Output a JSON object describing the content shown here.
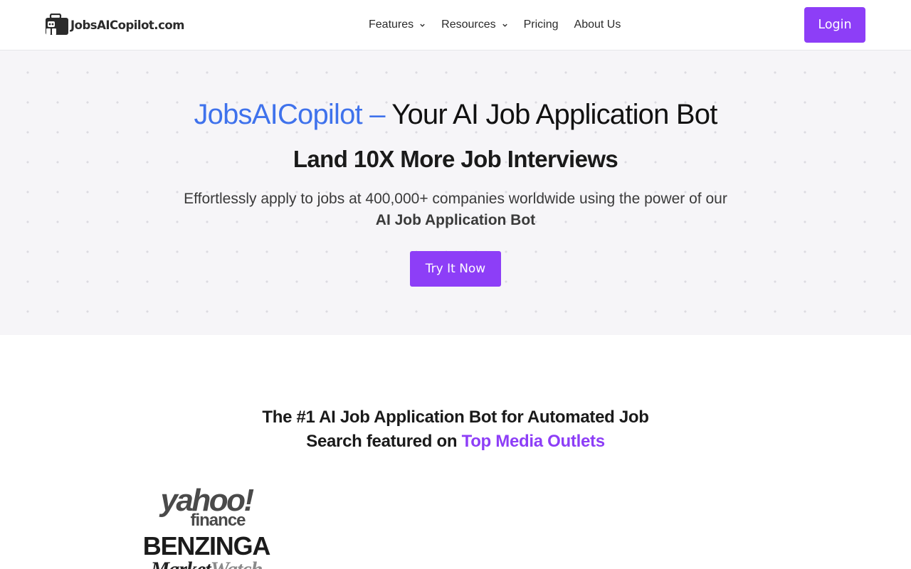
{
  "header": {
    "logo_text": "JobsAICopilot.com",
    "nav": [
      {
        "label": "Features",
        "has_dropdown": true
      },
      {
        "label": "Resources",
        "has_dropdown": true
      },
      {
        "label": "Pricing",
        "has_dropdown": false
      },
      {
        "label": "About Us",
        "has_dropdown": false
      }
    ],
    "login_label": "Login"
  },
  "hero": {
    "title_brand": "JobsAICopilot",
    "title_dash": " – ",
    "title_rest": "Your AI Job Application Bot",
    "subtitle": "Land 10X More Job Interviews",
    "description": "Effortlessly apply to jobs at 400,000+ companies worldwide using the power of our",
    "description_bold": "AI Job Application Bot",
    "cta_label": "Try It Now"
  },
  "featured": {
    "title_line1": "The #1 AI Job Application Bot for Automated Job",
    "title_line2_prefix": "Search featured on ",
    "title_line2_accent": "Top Media Outlets",
    "logos": {
      "yahoo_main": "yahoo!",
      "yahoo_sub": "finance",
      "benzinga": "BENZINGA",
      "marketwatch_a": "Market",
      "marketwatch_b": "Watch"
    }
  },
  "colors": {
    "accent_purple": "#8d3ef7",
    "brand_blue": "#3f72ec",
    "hero_bg": "#f6f5f8"
  }
}
